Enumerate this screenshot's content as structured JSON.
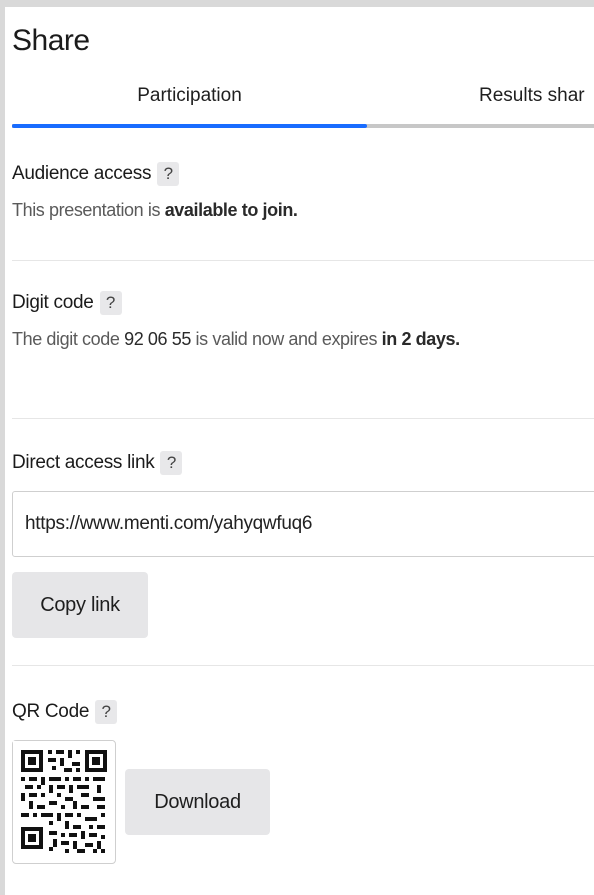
{
  "header": {
    "title": "Share"
  },
  "tabs": [
    {
      "label": "Participation"
    },
    {
      "label": "Results shar"
    }
  ],
  "audience": {
    "label": "Audience access",
    "help": "?",
    "text_prefix": "This presentation is ",
    "text_bold": "available to join."
  },
  "digit": {
    "label": "Digit code",
    "help": "?",
    "text_prefix": "The digit code ",
    "code": "92 06 55",
    "text_middle": " is valid now and expires ",
    "text_bold": "in 2 days."
  },
  "link": {
    "label": "Direct access link",
    "help": "?",
    "value": "https://www.menti.com/yahyqwfuq6",
    "copy_label": "Copy link"
  },
  "qr": {
    "label": "QR Code",
    "help": "?",
    "download_label": "Download"
  }
}
